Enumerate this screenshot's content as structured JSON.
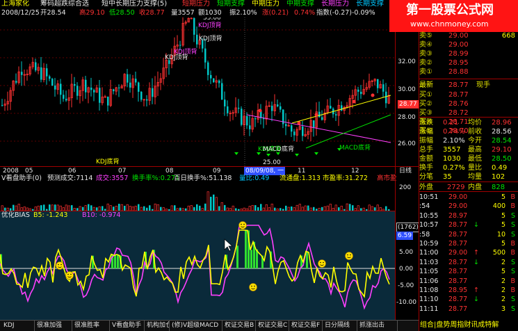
{
  "header": {
    "stock_name": "上海家化",
    "title": "筹码超跌综合选",
    "subtitle": "短中长期压力支撑(5)",
    "legend": [
      {
        "text": "短期压力",
        "color": "#ff3232"
      },
      {
        "text": "短期支撑",
        "color": "#00e600"
      },
      {
        "text": "中期压力",
        "color": "#ffff00"
      },
      {
        "text": "中期支撑",
        "color": "#00e600"
      },
      {
        "text": "长期压力",
        "color": "#ff40ff"
      },
      {
        "text": "长期支撑",
        "color": "#00c8ff"
      }
    ]
  },
  "ohlc": {
    "date": "2008/12/25",
    "open": "开28.54",
    "high": "高29.10",
    "low": "低28.50",
    "close": "收28.77",
    "volume": "量3557",
    "amount": "额1030",
    "amplitude": "振2.10%",
    "change": "涨(0.21)",
    "change_pct": "0.74%",
    "index": "指数(-0.27)-0.09%"
  },
  "price_axis": [
    "32.00",
    "30.00",
    "28.00",
    "26.00"
  ],
  "current_price": "28.77",
  "annotations": [
    {
      "text": "KDJ顶背"
    },
    {
      "text": "KDJ顶背"
    },
    {
      "text": "KDJ顶背"
    },
    {
      "text": "KDJ顶背"
    },
    {
      "text": "KDJ底背"
    },
    {
      "text": "KDJ底背"
    },
    {
      "text": "MACD底背"
    },
    {
      "text": "MACD底背"
    },
    {
      "text": "35.00"
    },
    {
      "text": "25.00"
    }
  ],
  "x_axis": [
    "2008",
    "05",
    "06",
    "07",
    "08",
    "09",
    "08/09/08, 一",
    "11",
    "12"
  ],
  "x_axis_right": "日线",
  "volume_panel": {
    "title": "V看盘助手(0)",
    "fields": [
      {
        "label": "预测成交:",
        "value": "7114",
        "color": "#e8e8e8"
      },
      {
        "label": "成交:",
        "value": "3557",
        "color": "#ff40ff"
      },
      {
        "label": "换手率%:",
        "value": "0.271",
        "color": "#00e600"
      },
      {
        "label": "百日换手%:",
        "value": "51.138",
        "color": "#e8e8e8"
      },
      {
        "label": "量比:",
        "value": "0.49",
        "color": "#00c8ff"
      },
      {
        "label": "流通盘:",
        "value": "1.313",
        "color": "#ffff00"
      },
      {
        "label": "市盈率:",
        "value": "31.272",
        "color": "#ffff00"
      },
      {
        "label": "",
        "value": "高市盈",
        "color": "#ff3232"
      }
    ],
    "axis": "200"
  },
  "indicator_panel": {
    "title": "优化BIAS",
    "b5": "B5: -1.243",
    "b10": "B10: -0.974",
    "axis": [
      "5.00",
      "0.00",
      "-5.00",
      "-10.00"
    ],
    "top_box": "(1762)",
    "top_value": "6.59"
  },
  "tabs": [
    "KDJ",
    "很准加强",
    "很准胜率",
    "V看盘助手",
    "机构加仓",
    "(修)V超级MACD",
    "权证交易B",
    "权证交易C",
    "权证交易F",
    "日分隔线",
    "抓涨出击"
  ],
  "watermark": {
    "title": "第一股票公式网",
    "url": "www.chnmoney.com",
    "bottom": "组合|盘势周指财讯成特解"
  },
  "quotes": {
    "sell": [
      {
        "label": "卖⑤",
        "price": "29.00",
        "vol": "668"
      },
      {
        "label": "卖④",
        "price": "29.00",
        "vol": ""
      },
      {
        "label": "卖③",
        "price": "28.99",
        "vol": ""
      },
      {
        "label": "卖②",
        "price": "28.95",
        "vol": ""
      },
      {
        "label": "卖①",
        "price": "28.88",
        "vol": ""
      }
    ],
    "latest": {
      "label": "最新",
      "price": "28.77",
      "tag": "现手"
    },
    "buy": [
      {
        "label": "买①",
        "price": "28.77",
        "vol": ""
      },
      {
        "label": "买②",
        "price": "28.76",
        "vol": ""
      },
      {
        "label": "买③",
        "price": "28.72",
        "vol": ""
      },
      {
        "label": "买④",
        "price": "28.71",
        "vol": ""
      },
      {
        "label": "买⑤",
        "price": "28.70",
        "vol": ""
      }
    ],
    "stats": [
      {
        "l1": "涨跌",
        "v1": "0.21",
        "c1": "#ff3232",
        "l2": "均价",
        "v2": "28.96",
        "c2": "#ff3232"
      },
      {
        "l1": "涨幅",
        "v1": "0.74%",
        "c1": "#ff3232",
        "l2": "前收",
        "v2": "28.56",
        "c2": "#e8e8e8"
      },
      {
        "l1": "振幅",
        "v1": "2.10%",
        "c1": "#e8e8e8",
        "l2": "今开",
        "v2": "28.54",
        "c2": "#00e600"
      },
      {
        "l1": "总手",
        "v1": "3557",
        "c1": "#ffff00",
        "l2": "最高",
        "v2": "29.10",
        "c2": "#ff3232"
      },
      {
        "l1": "金额",
        "v1": "1030",
        "c1": "#ffff00",
        "l2": "最低",
        "v2": "28.50",
        "c2": "#00e600"
      },
      {
        "l1": "换手",
        "v1": "0.27%",
        "c1": "#ffff00",
        "l2": "量比",
        "v2": "0.49",
        "c2": "#ffff00"
      },
      {
        "l1": "分笔",
        "v1": "35",
        "c1": "#ffff00",
        "l2": "均量",
        "v2": "102",
        "c2": "#ffff00"
      }
    ],
    "outer": {
      "label": "外盘",
      "value": "2729",
      "label2": "内盘",
      "value2": "828"
    }
  },
  "ticks": [
    {
      "time": "10:51",
      "price": "29.00",
      "pc": "#ff3232",
      "arrow": "",
      "vol": "5",
      "side": "B"
    },
    {
      "time": ":54",
      "price": "29.00",
      "pc": "#ff3232",
      "arrow": "",
      "vol": "400",
      "side": "B"
    },
    {
      "time": "10:55",
      "price": "28.97",
      "pc": "#ff3232",
      "arrow": "",
      "vol": "5",
      "side": "S"
    },
    {
      "time": "10:57",
      "price": "28.77",
      "pc": "#ff3232",
      "arrow": "↓",
      "vol": "5",
      "side": "S"
    },
    {
      "time": ":58",
      "price": "28.77",
      "pc": "#ff3232",
      "arrow": "",
      "vol": "10",
      "side": "S"
    },
    {
      "time": "10:59",
      "price": "28.77",
      "pc": "#ff3232",
      "arrow": "",
      "vol": "5",
      "side": "B"
    },
    {
      "time": "11:00",
      "price": "29.00",
      "pc": "#ff3232",
      "arrow": "↑",
      "vol": "500",
      "side": "B"
    },
    {
      "time": "11:03",
      "price": "28.77",
      "pc": "#ff3232",
      "arrow": "↓",
      "vol": "2",
      "side": "S"
    },
    {
      "time": "11:05",
      "price": "28.77",
      "pc": "#ff3232",
      "arrow": "",
      "vol": "5",
      "side": "S"
    },
    {
      "time": "11:06",
      "price": "28.77",
      "pc": "#ff3232",
      "arrow": "",
      "vol": "2",
      "side": "B"
    },
    {
      "time": "11:08",
      "price": "28.95",
      "pc": "#ff3232",
      "arrow": "↑",
      "vol": "2",
      "side": "B"
    },
    {
      "time": "11:10",
      "price": "28.77",
      "pc": "#ff3232",
      "arrow": "↓",
      "vol": "2",
      "side": "S"
    },
    {
      "time": "11:11",
      "price": "28.77",
      "pc": "#ff3232",
      "arrow": "",
      "vol": "3",
      "side": "S"
    }
  ],
  "colors": {
    "up": "#ff3232",
    "down": "#00c8c8",
    "grid": "#800000",
    "bias_bg": "#0a2a3a"
  }
}
